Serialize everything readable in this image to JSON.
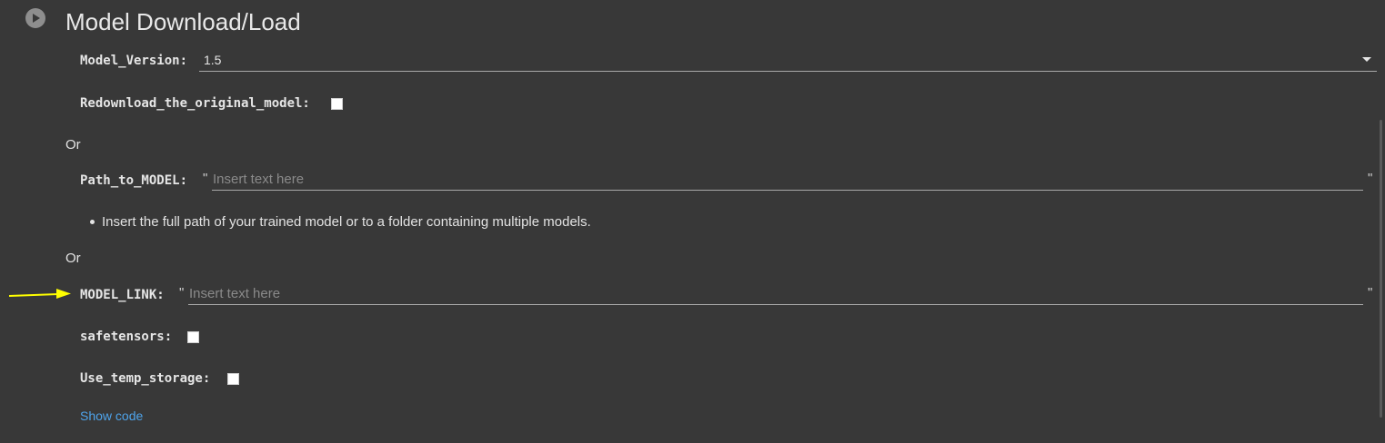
{
  "title": "Model Download/Load",
  "fields": {
    "model_version": {
      "label": "Model_Version:",
      "value": "1.5"
    },
    "redownload": {
      "label": "Redownload_the_original_model:",
      "checked": false
    },
    "or1": "Or",
    "path_to_model": {
      "label": "Path_to_MODEL:",
      "placeholder": "Insert text here",
      "quote_open": "\"",
      "quote_close": "\""
    },
    "bullet": "Insert the full path of your trained model or to a folder containing multiple models.",
    "or2": "Or",
    "model_link": {
      "label": "MODEL_LINK:",
      "placeholder": "Insert text here",
      "quote_open": "\"",
      "quote_close": "\""
    },
    "safetensors": {
      "label": "safetensors:",
      "checked": false
    },
    "use_temp_storage": {
      "label": "Use_temp_storage:",
      "checked": false
    }
  },
  "show_code": "Show code",
  "colors": {
    "background": "#383838",
    "link": "#4ea3ea",
    "arrow": "#ffff00"
  }
}
